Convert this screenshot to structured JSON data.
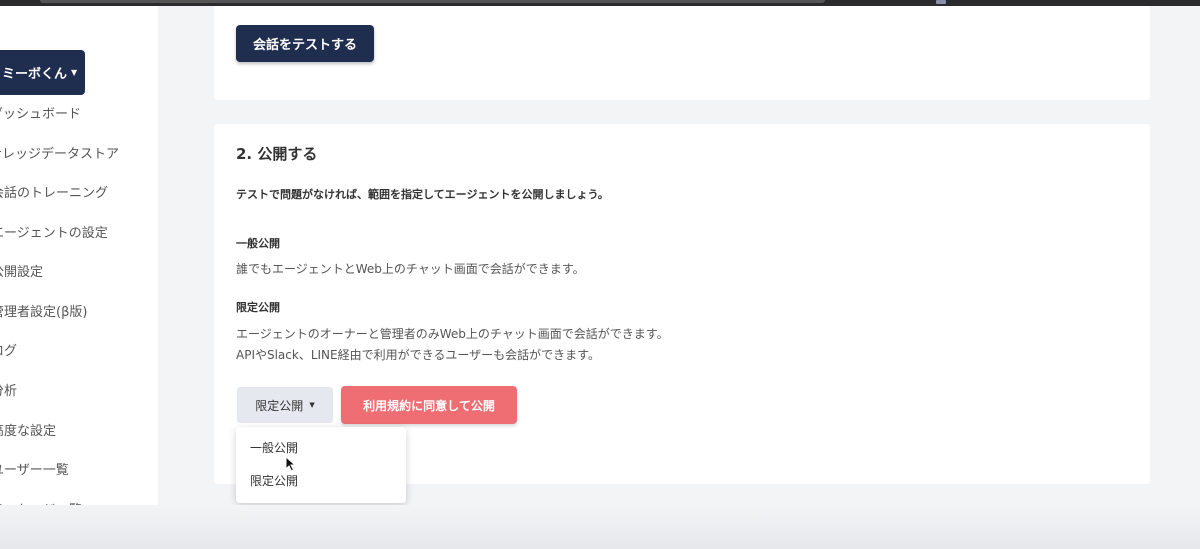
{
  "sidebar": {
    "bot_name": "ミーボくん",
    "items": [
      {
        "label": "ダッシュボード"
      },
      {
        "label": "ナレッジデータストア"
      },
      {
        "label": "会話のトレーニング"
      },
      {
        "label": "エージェントの設定"
      },
      {
        "label": "公開設定"
      },
      {
        "label": "管理者設定(β版)"
      },
      {
        "label": "ログ"
      },
      {
        "label": "分析"
      },
      {
        "label": "高度な設定"
      },
      {
        "label": "ユーザー一覧"
      },
      {
        "label": "メッセージ一覧"
      }
    ]
  },
  "test_section": {
    "button_label": "会話をテストする"
  },
  "publish_section": {
    "title": "2. 公開する",
    "lead": "テストで問題がなければ、範囲を指定してエージェントを公開しましょう。",
    "general": {
      "title": "一般公開",
      "desc": "誰でもエージェントとWeb上のチャット画面で会話ができます。"
    },
    "limited": {
      "title": "限定公開",
      "desc1": "エージェントのオーナーと管理者のみWeb上のチャット画面で会話ができます。",
      "desc2": "APIやSlack、LINE経由で利用ができるユーザーも会話ができます。"
    },
    "dropdown_selected": "限定公開",
    "publish_button": "利用規約に同意して公開",
    "dropdown_options": [
      "一般公開",
      "限定公開"
    ]
  }
}
